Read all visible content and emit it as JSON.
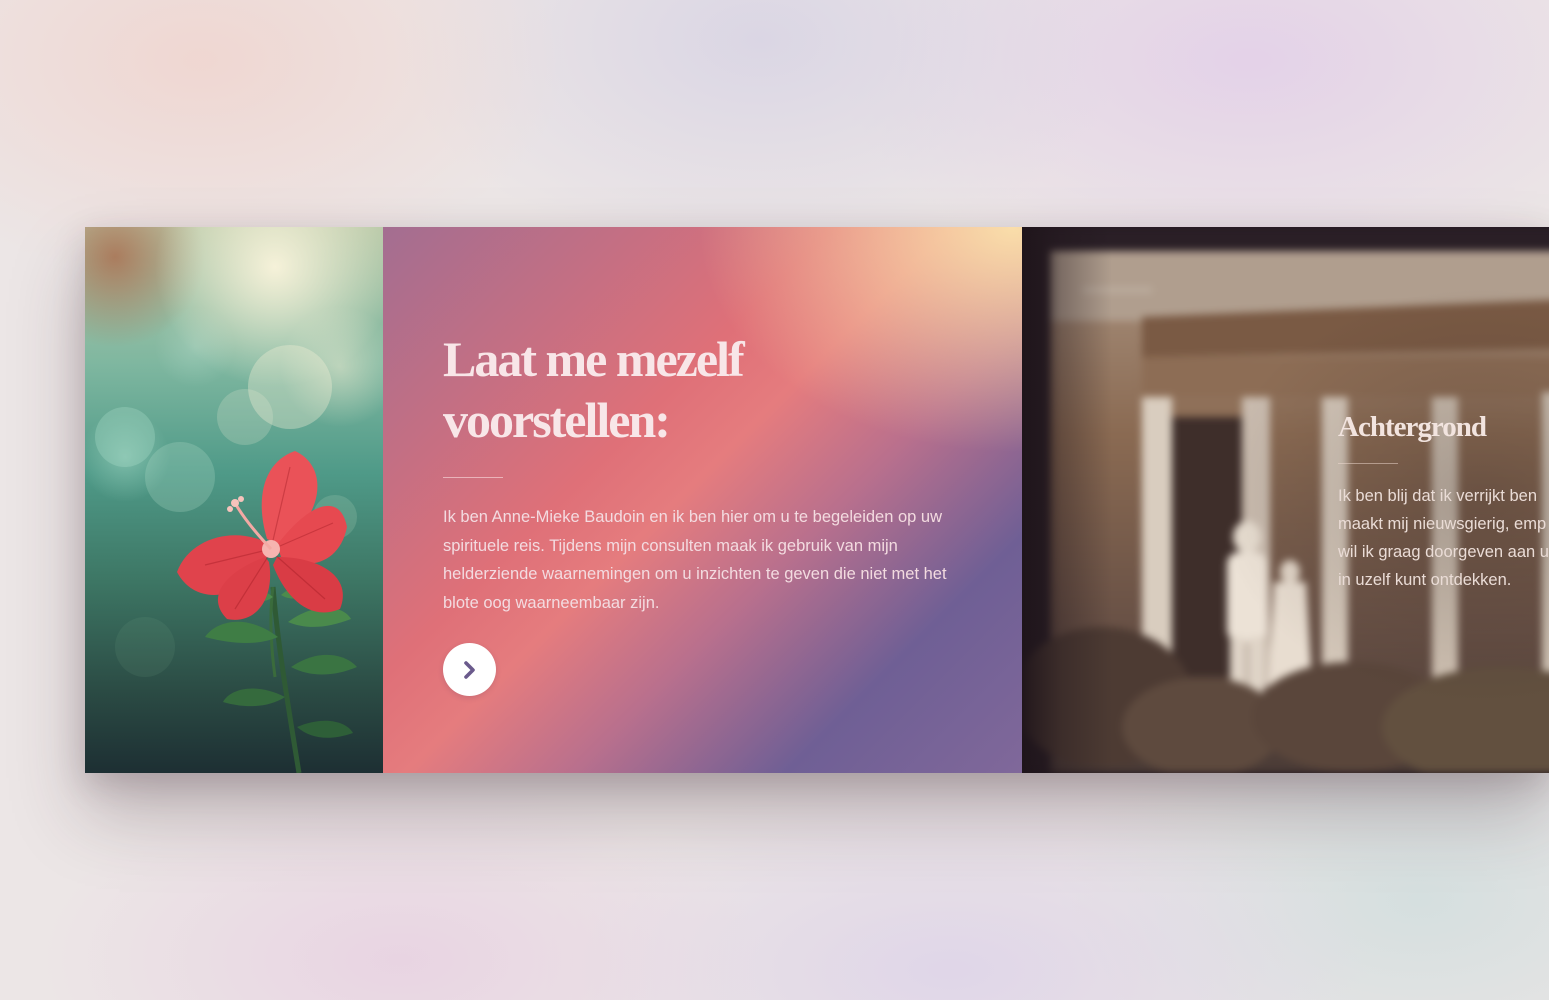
{
  "slider": {
    "slides": [
      {
        "image_alt": "red-hibiscus-flower",
        "title_line_1": "Laat me mezelf",
        "title_line_2": "voorstellen:",
        "text": "Ik ben Anne-Mieke Baudoin en ik ben hier om u te begeleiden op uw spirituele reis. Tijdens mijn consulten maak ik gebruik van mijn helderziende waarnemingen om u inzichten te geven die niet met het blote oog waarneembaar zijn.",
        "button_icon": "chevron-right-icon"
      },
      {
        "image_alt": "vintage-house-photo",
        "title": "Achtergrond",
        "text_lines": [
          "Ik ben blij dat ik verrijkt ben",
          "maakt mij nieuwsgierig, emp",
          "wil ik graag doorgeven aan u",
          "in uzelf kunt ontdekken."
        ]
      }
    ]
  },
  "colors": {
    "panel_gradient_start": "#f8d8a8",
    "panel_gradient_mid": "#e27478",
    "panel_gradient_end": "#6f5f95",
    "title_color": "#f8e6e8",
    "button_background": "#ffffff",
    "button_icon": "#6a5a8c"
  }
}
